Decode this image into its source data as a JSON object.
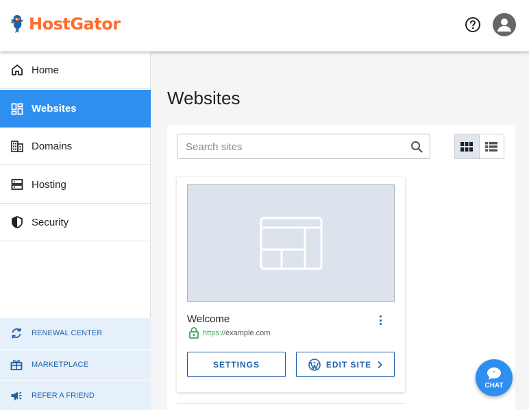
{
  "header": {
    "brand": "HostGator",
    "help_icon": "help-circle-icon",
    "avatar_icon": "user-avatar-icon"
  },
  "sidebar": {
    "items": [
      {
        "label": "Home",
        "icon": "home-icon",
        "active": false
      },
      {
        "label": "Websites",
        "icon": "dashboard-icon",
        "active": true
      },
      {
        "label": "Domains",
        "icon": "building-icon",
        "active": false
      },
      {
        "label": "Hosting",
        "icon": "server-icon",
        "active": false
      },
      {
        "label": "Security",
        "icon": "shield-icon",
        "active": false
      }
    ],
    "bottom_items": [
      {
        "label": "RENEWAL CENTER",
        "icon": "refresh-icon"
      },
      {
        "label": "MARKETPLACE",
        "icon": "gift-icon"
      },
      {
        "label": "REFER A FRIEND",
        "icon": "megaphone-icon"
      }
    ]
  },
  "main": {
    "title": "Websites",
    "search": {
      "placeholder": "Search sites",
      "value": ""
    },
    "view_toggle": {
      "grid_icon": "grid-view-icon",
      "list_icon": "list-view-icon",
      "selected": "grid"
    },
    "site_card": {
      "name": "Welcome",
      "url_prefix": "https://",
      "url_host": "example.com",
      "settings_label": "SETTINGS",
      "edit_label": "EDIT SITE"
    }
  },
  "chat": {
    "label": "CHAT"
  },
  "colors": {
    "brand_orange": "#ff6c2c",
    "accent_blue": "#2f8ff0",
    "link_blue": "#1f5fa8",
    "secure_green": "#3aa757"
  }
}
